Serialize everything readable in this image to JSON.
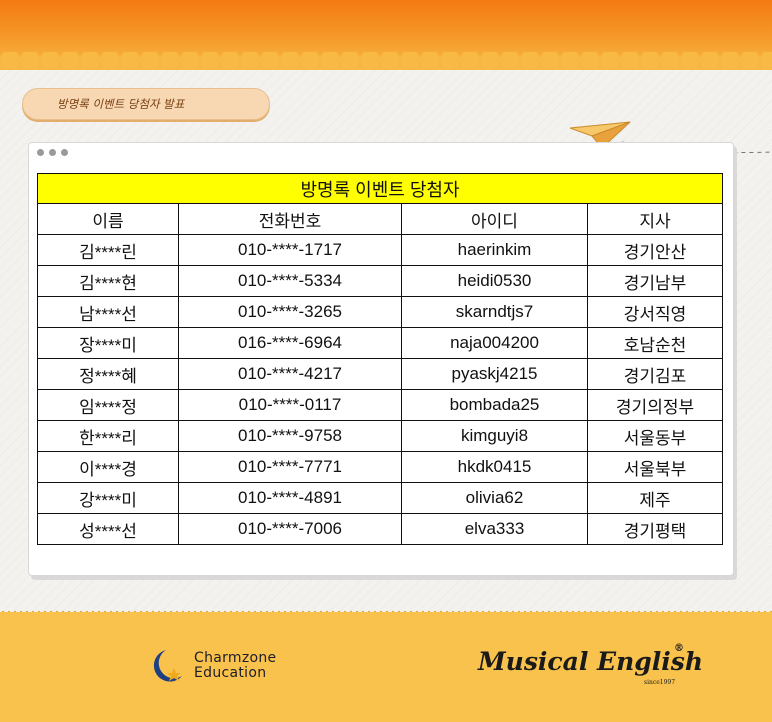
{
  "header": {
    "badge_text": "방명록 이벤트 당첨자 발표"
  },
  "table": {
    "title": "방명록 이벤트 당첨자",
    "columns": [
      "이름",
      "전화번호",
      "아이디",
      "지사"
    ],
    "rows": [
      [
        "김****린",
        "010-****-1717",
        "haerinkim",
        "경기안산"
      ],
      [
        "김****현",
        "010-****-5334",
        "heidi0530",
        "경기남부"
      ],
      [
        "남****선",
        "010-****-3265",
        "skarndtjs7",
        "강서직영"
      ],
      [
        "장****미",
        "016-****-6964",
        "naja004200",
        "호남순천"
      ],
      [
        "정****혜",
        "010-****-4217",
        "pyaskj4215",
        "경기김포"
      ],
      [
        "임****정",
        "010-****-0117",
        "bombada25",
        "경기의정부"
      ],
      [
        "한****리",
        "010-****-9758",
        "kimguyi8",
        "서울동부"
      ],
      [
        "이****경",
        "010-****-7771",
        "hkdk0415",
        "서울북부"
      ],
      [
        "강****미",
        "010-****-4891",
        "olivia62",
        "제주"
      ],
      [
        "성****선",
        "010-****-7006",
        "elva333",
        "경기평택"
      ]
    ]
  },
  "footer": {
    "logo1_line1": "Charmzone",
    "logo1_line2": "Education",
    "logo2_name": "Musical English",
    "logo2_reg": "®",
    "logo2_since": "since1997"
  },
  "colors": {
    "top_band": "#f47a12",
    "title_row": "#ffff00",
    "footer": "#f9c24d"
  }
}
